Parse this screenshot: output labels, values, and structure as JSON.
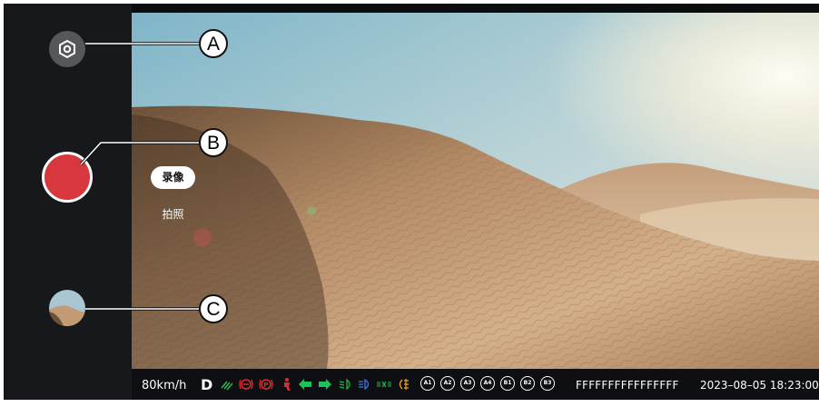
{
  "sidebar": {
    "settings": {
      "icon": "hexagon-gear-icon"
    },
    "record": {
      "icon": "record-icon",
      "color": "#d7373d"
    },
    "gallery": {
      "icon": "gallery-thumbnail"
    }
  },
  "modes": {
    "video_label": "录像",
    "photo_label": "拍照",
    "selected": "录像"
  },
  "status": {
    "speed": "80km/h",
    "gear": "D",
    "vin": "FFFFFFFFFFFFFFFF",
    "datetime": "2023–08–05 18:23:00",
    "indicators": [
      {
        "name": "wiper-fluid-icon",
        "color": "#2fbf4f"
      },
      {
        "name": "brake-warning-icon",
        "color": "#e02a2a"
      },
      {
        "name": "parking-brake-icon",
        "color": "#e02a2a"
      },
      {
        "name": "seatbelt-warning-icon",
        "color": "#e02a2a"
      },
      {
        "name": "left-turn-signal-icon",
        "color": "#1fc15a"
      },
      {
        "name": "right-turn-signal-icon",
        "color": "#1fc15a"
      },
      {
        "name": "low-beam-icon",
        "color": "#21b14d"
      },
      {
        "name": "high-beam-icon",
        "color": "#2f7ff2"
      },
      {
        "name": "position-light-icon",
        "color": "#21b14d"
      },
      {
        "name": "rear-fog-light-icon",
        "color": "#f2a116"
      }
    ],
    "circles": [
      "A1",
      "A2",
      "A3",
      "A4",
      "B1",
      "B2",
      "B3"
    ]
  },
  "callouts": {
    "a": "A",
    "b": "B",
    "c": "C"
  }
}
